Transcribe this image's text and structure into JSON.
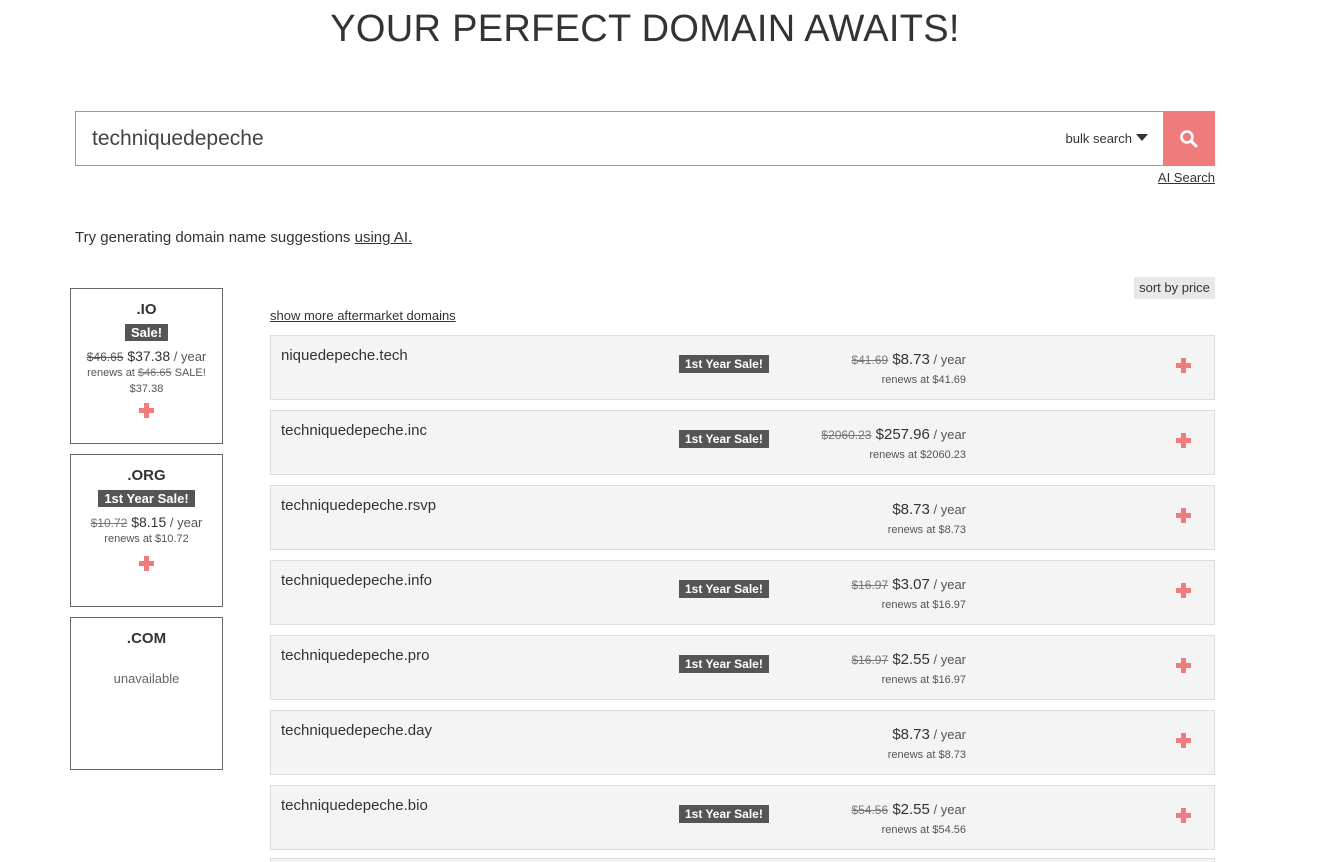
{
  "header": {
    "title": "YOUR PERFECT DOMAIN AWAITS!"
  },
  "search": {
    "value": "techniquedepeche",
    "bulk_label": "bulk search",
    "ai_search_label": "AI Search"
  },
  "ai_hint": {
    "text": "Try generating domain name suggestions ",
    "link": "using AI."
  },
  "controls": {
    "sort_label": "sort by price",
    "aftermarket_label": "show more aftermarket domains"
  },
  "tld_cards": [
    {
      "name": ".IO",
      "badge": "Sale!",
      "old_price": "$46.65",
      "price": "$37.38",
      "per": " / year",
      "renew_prefix": "renews at ",
      "renew_old": "$46.65",
      "renew_suffix": " SALE!",
      "renew_price": "$37.38"
    },
    {
      "name": ".ORG",
      "badge": "1st Year Sale!",
      "old_price": "$10.72",
      "price": "$8.15",
      "per": " / year",
      "renew_text": "renews at $10.72"
    },
    {
      "name": ".COM",
      "status": "unavailable"
    }
  ],
  "results": [
    {
      "domain": "niquedepeche.tech",
      "badge": "1st Year Sale!",
      "old_price": "$41.69",
      "price": "$8.73",
      "per": " / year",
      "renew": "renews at $41.69"
    },
    {
      "domain": "techniquedepeche.inc",
      "badge": "1st Year Sale!",
      "old_price": "$2060.23",
      "price": "$257.96",
      "per": " / year",
      "renew": "renews at $2060.23"
    },
    {
      "domain": "techniquedepeche.rsvp",
      "badge": "",
      "old_price": "",
      "price": "$8.73",
      "per": " / year",
      "renew": "renews at $8.73"
    },
    {
      "domain": "techniquedepeche.info",
      "badge": "1st Year Sale!",
      "old_price": "$16.97",
      "price": "$3.07",
      "per": " / year",
      "renew": "renews at $16.97"
    },
    {
      "domain": "techniquedepeche.pro",
      "badge": "1st Year Sale!",
      "old_price": "$16.97",
      "price": "$2.55",
      "per": " / year",
      "renew": "renews at $16.97"
    },
    {
      "domain": "techniquedepeche.day",
      "badge": "",
      "old_price": "",
      "price": "$8.73",
      "per": " / year",
      "renew": "renews at $8.73"
    },
    {
      "domain": "techniquedepeche.bio",
      "badge": "1st Year Sale!",
      "old_price": "$54.56",
      "price": "$2.55",
      "per": " / year",
      "renew": "renews at $54.56"
    }
  ],
  "colors": {
    "accent": "#ef7b7c",
    "badge_bg": "#555555",
    "row_bg": "#f4f4f4"
  }
}
